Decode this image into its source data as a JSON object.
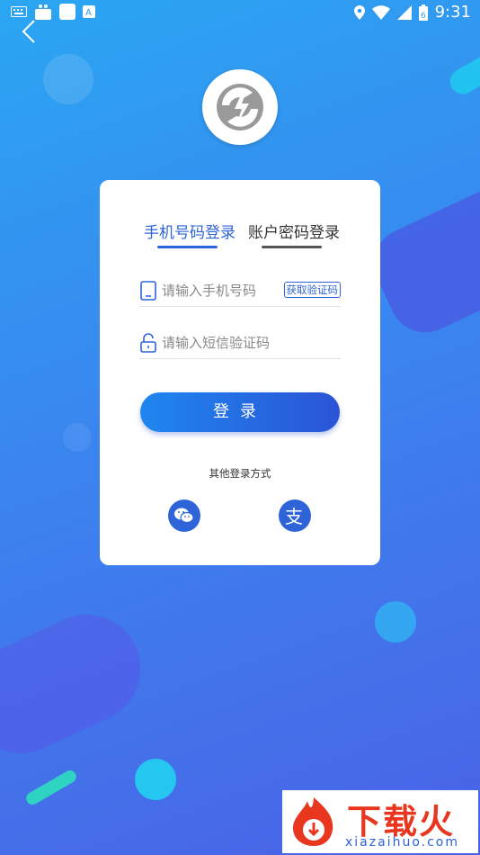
{
  "status_bar": {
    "time": "9:31",
    "battery_level": "6"
  },
  "brand_color": "#2f64d8",
  "login_card": {
    "tabs": [
      {
        "label": "手机号码登录",
        "active": true
      },
      {
        "label": "账户密码登录",
        "active": false
      }
    ],
    "phone_field": {
      "placeholder": "请输入手机号码",
      "icon": "phone-icon"
    },
    "get_code_button": "获取验证码",
    "sms_field": {
      "placeholder": "请输入短信验证码",
      "icon": "lock-icon"
    },
    "login_button": "登录",
    "other_methods_label": "其他登录方式",
    "social": [
      {
        "name": "wechat",
        "icon": "wechat-icon"
      },
      {
        "name": "alipay",
        "icon": "alipay-icon",
        "glyph": "支"
      }
    ]
  },
  "watermark": {
    "brand": "下载火",
    "url": "xiazaihuo.com"
  }
}
